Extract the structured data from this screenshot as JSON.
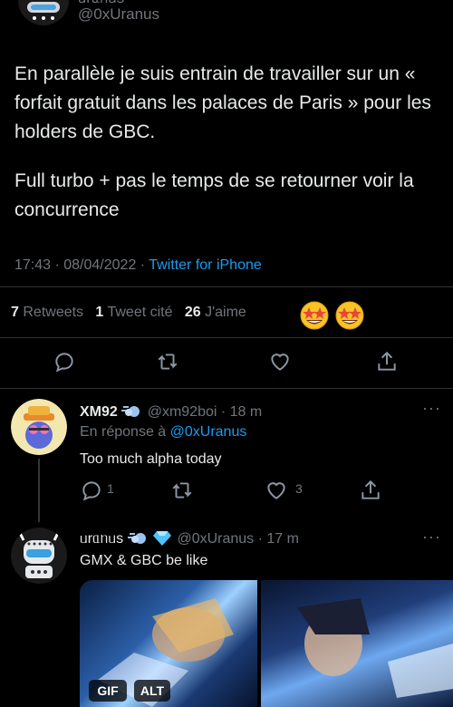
{
  "main_tweet": {
    "handle": "@0xUranus",
    "text_para1": "En parallèle je suis entrain de travailler sur un « forfait gratuit dans les palaces de Paris » pour les holders de GBC.",
    "text_para2": "Full turbo + pas le temps de se retourner voir la concurrence",
    "time": "17:43 · 08/04/2022 · ",
    "source": "Twitter for iPhone",
    "retweets_count": "7",
    "retweets_label": "Retweets",
    "quotes_count": "1",
    "quotes_label": "Tweet cité",
    "likes_count": "26",
    "likes_label": "J'aime"
  },
  "reply1": {
    "name": "XM92",
    "handle_time": "@xm92boi · 18 m",
    "in_reply_prefix": "En réponse à ",
    "in_reply_handle": "@0xUranus",
    "text": "Too much alpha today",
    "reply_count": "1",
    "like_count": "3"
  },
  "reply2": {
    "name": "ᥙrᥲᥒᥙs",
    "handle_time": "@0xUranus · 17 m",
    "text": "GMX & GBC be like",
    "media_badges": [
      "GIF",
      "ALT"
    ]
  },
  "colors": {
    "background": "#000000",
    "text": "#e7e9ea",
    "secondary": "#71767b",
    "accent": "#1d9bf0"
  }
}
